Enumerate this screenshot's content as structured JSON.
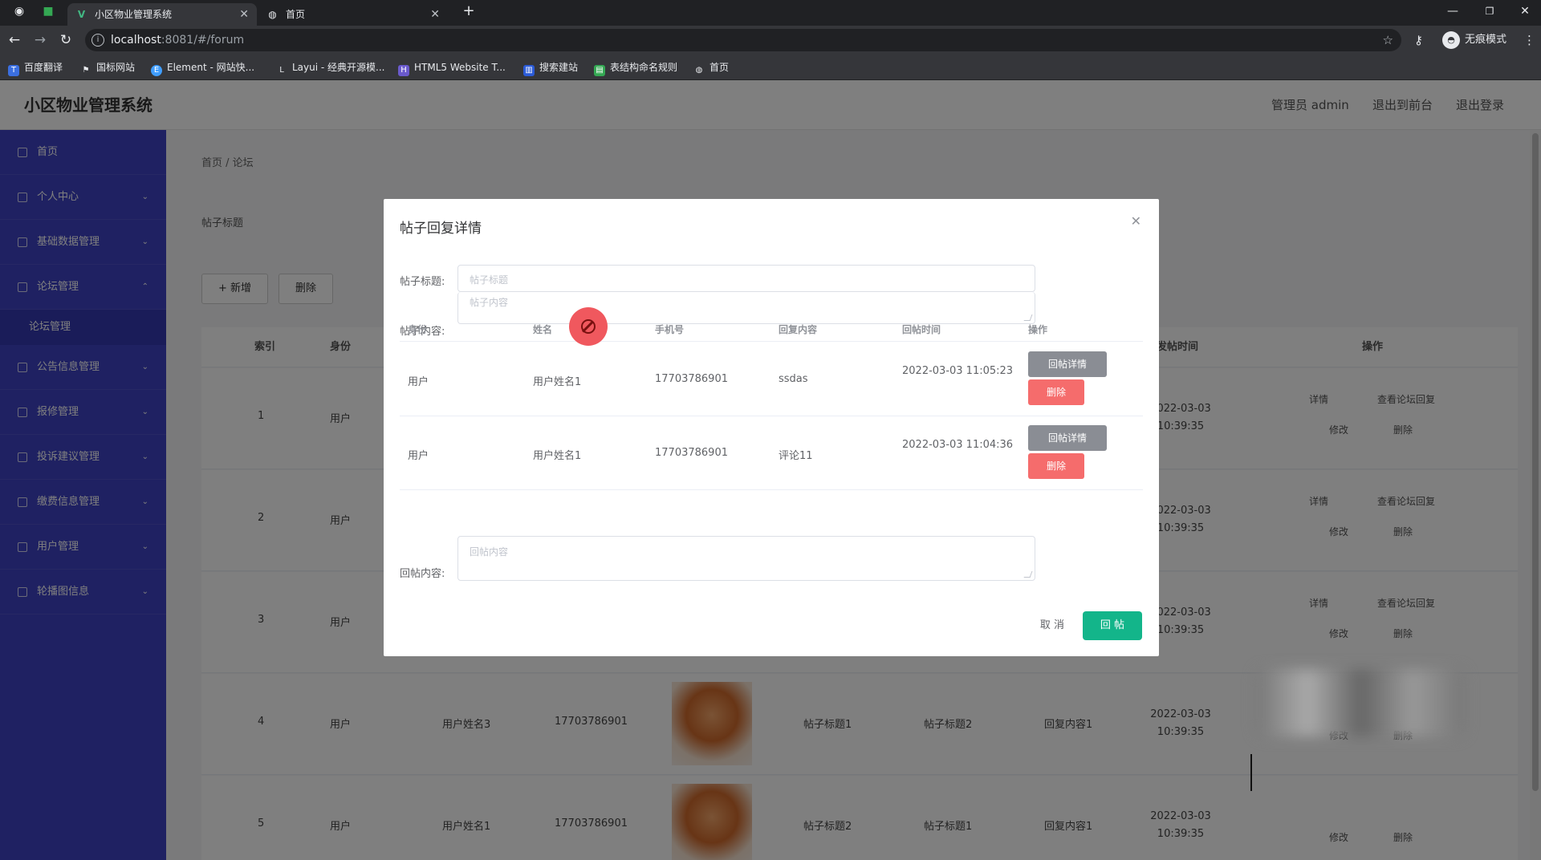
{
  "browser": {
    "tabs": [
      {
        "label": "小区物业管理系统",
        "active": true
      },
      {
        "label": "首页",
        "active": false
      }
    ],
    "url_host": "localhost",
    "url_rest": ":8081/#/forum",
    "incognito_label": "无痕模式",
    "bookmarks": [
      "百度翻译",
      "国标网站",
      "Element - 网站快...",
      "Layui - 经典开源模...",
      "HTML5 Website T...",
      "搜索建站",
      "表结构命名规则",
      "首页"
    ]
  },
  "header": {
    "brand": "小区物业管理系统",
    "role_user": "管理员 admin",
    "exit_home": "退出到前台",
    "logout": "退出登录"
  },
  "sidebar": {
    "items": [
      {
        "label": "首页"
      },
      {
        "label": "个人中心"
      },
      {
        "label": "基础数据管理"
      },
      {
        "label": "论坛管理"
      },
      {
        "label": "公告信息管理"
      },
      {
        "label": "报修管理"
      },
      {
        "label": "投诉建议管理"
      },
      {
        "label": "缴费信息管理"
      },
      {
        "label": "用户管理"
      },
      {
        "label": "轮播图信息"
      }
    ],
    "sub_item": "论坛管理"
  },
  "content": {
    "breadcrumb": "首页 / 论坛",
    "filter": "帖子标题",
    "buttons": {
      "add": "+ 新增",
      "delete": "删除"
    },
    "columns": [
      "索引",
      "身份",
      "发帖时间",
      "操作"
    ],
    "rows": [
      {
        "index": "1",
        "role": "用户",
        "name": "",
        "phone": "",
        "title": "",
        "content": "",
        "reply": "",
        "time": "2022-03-03 10:39:35"
      },
      {
        "index": "2",
        "role": "用户",
        "name": "",
        "phone": "",
        "title": "",
        "content": "",
        "reply": "",
        "time": "2022-03-03 10:39:35"
      },
      {
        "index": "3",
        "role": "用户",
        "name": "",
        "phone": "",
        "title": "",
        "content": "",
        "reply": "",
        "time": "2022-03-03 10:39:35"
      },
      {
        "index": "4",
        "role": "用户",
        "name": "用户姓名3",
        "phone": "17703786901",
        "title": "帖子标题1",
        "content": "帖子标题2",
        "reply": "回复内容1",
        "time": "2022-03-03 10:39:35"
      },
      {
        "index": "5",
        "role": "用户",
        "name": "用户姓名1",
        "phone": "17703786901",
        "title": "帖子标题2",
        "content": "帖子标题1",
        "reply": "回复内容1",
        "time": "2022-03-03 10:39:35"
      }
    ],
    "ops": {
      "detail": "详情",
      "view_reply": "查看论坛回复",
      "edit": "修改",
      "delete": "删除"
    }
  },
  "modal": {
    "title": "帖子回复详情",
    "post_title_label": "帖子标题:",
    "post_title_placeholder": "帖子标题",
    "post_content_label": "帖子内容:",
    "post_content_placeholder": "帖子内容",
    "columns": [
      "身份",
      "姓名",
      "手机号",
      "回复内容",
      "回帖时间",
      "操作"
    ],
    "rows": [
      {
        "role": "用户",
        "name": "用户姓名1",
        "phone": "17703786901",
        "content": "ssdas",
        "time": "2022-03-03 11:05:23"
      },
      {
        "role": "用户",
        "name": "用户姓名1",
        "phone": "17703786901",
        "content": "评论11",
        "time": "2022-03-03 11:04:36"
      }
    ],
    "row_detail_btn": "回帖详情",
    "row_delete_btn": "删除",
    "reply_label": "回帖内容:",
    "reply_placeholder": "回帖内容",
    "cancel": "取 消",
    "submit": "回 帖"
  }
}
